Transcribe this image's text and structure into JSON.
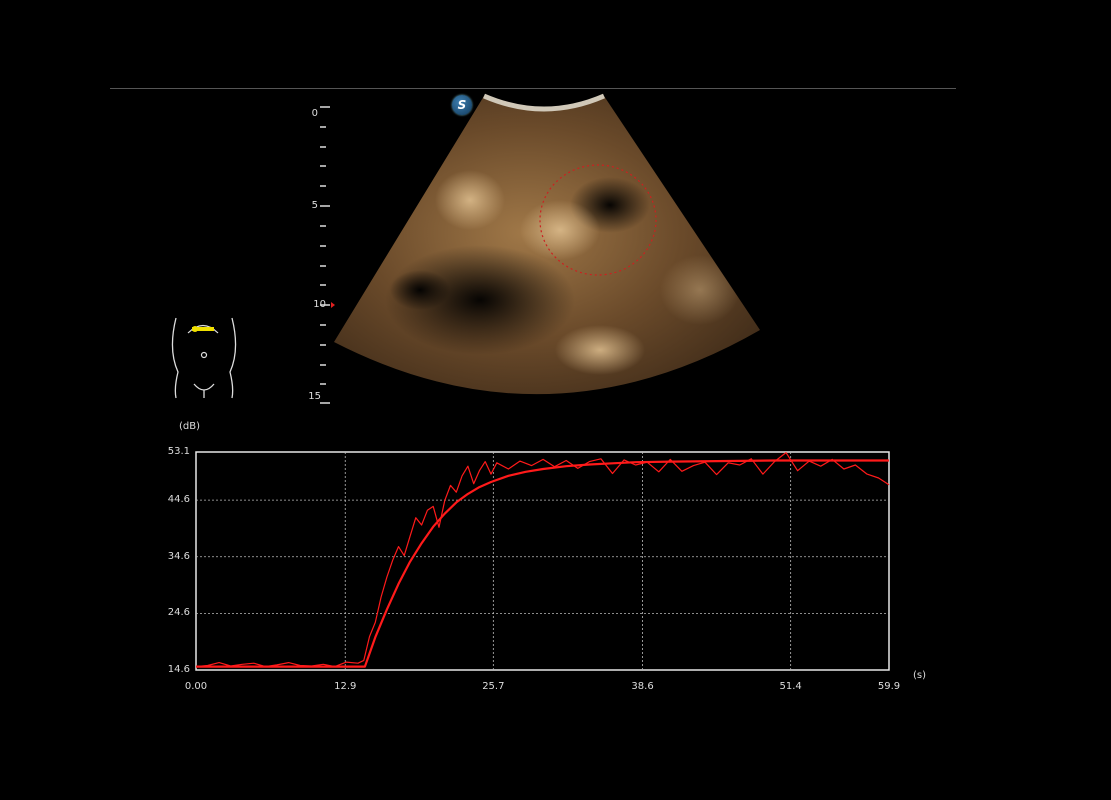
{
  "scan": {
    "badge_letter": "S",
    "depth_labels": [
      "0",
      "5",
      "10",
      "15"
    ],
    "body_marker_icon": "abdomen-body-marker-icon",
    "probe_marker_color": "#f0e000"
  },
  "chart_data": {
    "type": "line",
    "yunit": "(dB)",
    "xunit": "(s)",
    "xlim": [
      0,
      59.9
    ],
    "ylim": [
      14.6,
      53.1
    ],
    "xticks": [
      "0.00",
      "12.9",
      "25.7",
      "38.6",
      "51.4",
      "59.9"
    ],
    "yticks": [
      "53.1",
      "44.6",
      "34.6",
      "24.6",
      "14.6"
    ],
    "grid": true,
    "color": "#ff1a1a",
    "series": [
      {
        "x": [
          0,
          1,
          2,
          3,
          4,
          5,
          6,
          7,
          8,
          9,
          10,
          11,
          12,
          13,
          14,
          14.5,
          15,
          15.5,
          16,
          16.5,
          17,
          17.5,
          18,
          18.5,
          19,
          19.5,
          20,
          20.5,
          21,
          21.5,
          22,
          22.5,
          23,
          23.5,
          24,
          24.5,
          25,
          25.5,
          26,
          27,
          28,
          29,
          30,
          31,
          32,
          33,
          34,
          35,
          36,
          37,
          38,
          39,
          40,
          41,
          42,
          43,
          44,
          45,
          46,
          47,
          48,
          49,
          50,
          51,
          52,
          53,
          54,
          55,
          56,
          57,
          58,
          59,
          59.9
        ],
        "y": [
          15.2,
          15.4,
          15.9,
          15.3,
          15.6,
          15.8,
          15.2,
          15.5,
          15.9,
          15.4,
          15.3,
          15.6,
          15.2,
          16.0,
          15.8,
          16.3,
          20.5,
          23.0,
          27.5,
          31.0,
          34.0,
          36.4,
          34.8,
          38.2,
          41.5,
          40.2,
          42.8,
          43.5,
          39.8,
          44.5,
          47.2,
          46.0,
          48.9,
          50.6,
          47.5,
          49.8,
          51.4,
          49.2,
          51.2,
          50.1,
          51.5,
          50.7,
          51.8,
          50.5,
          51.6,
          50.2,
          51.4,
          51.9,
          49.3,
          51.7,
          50.8,
          51.3,
          49.6,
          51.8,
          49.7,
          50.7,
          51.3,
          49.1,
          51.2,
          50.8,
          51.9,
          49.2,
          51.4,
          53.0,
          49.8,
          51.5,
          50.6,
          51.8,
          50.1,
          50.8,
          49.2,
          48.5,
          47.3
        ]
      },
      {
        "x": [
          0,
          14.6,
          15.5,
          16.5,
          17.5,
          18.5,
          19.5,
          20.5,
          21.5,
          22.5,
          23.5,
          24.5,
          25.5,
          27,
          28.5,
          30,
          32,
          34,
          36,
          38,
          41,
          45,
          50,
          55,
          59.9
        ],
        "y": [
          15.2,
          15.2,
          20.4,
          25.3,
          29.8,
          33.7,
          37.0,
          39.9,
          42.2,
          44.2,
          45.7,
          46.9,
          47.8,
          48.9,
          49.6,
          50.1,
          50.6,
          50.9,
          51.1,
          51.3,
          51.4,
          51.5,
          51.6,
          51.6,
          51.6
        ]
      }
    ]
  }
}
